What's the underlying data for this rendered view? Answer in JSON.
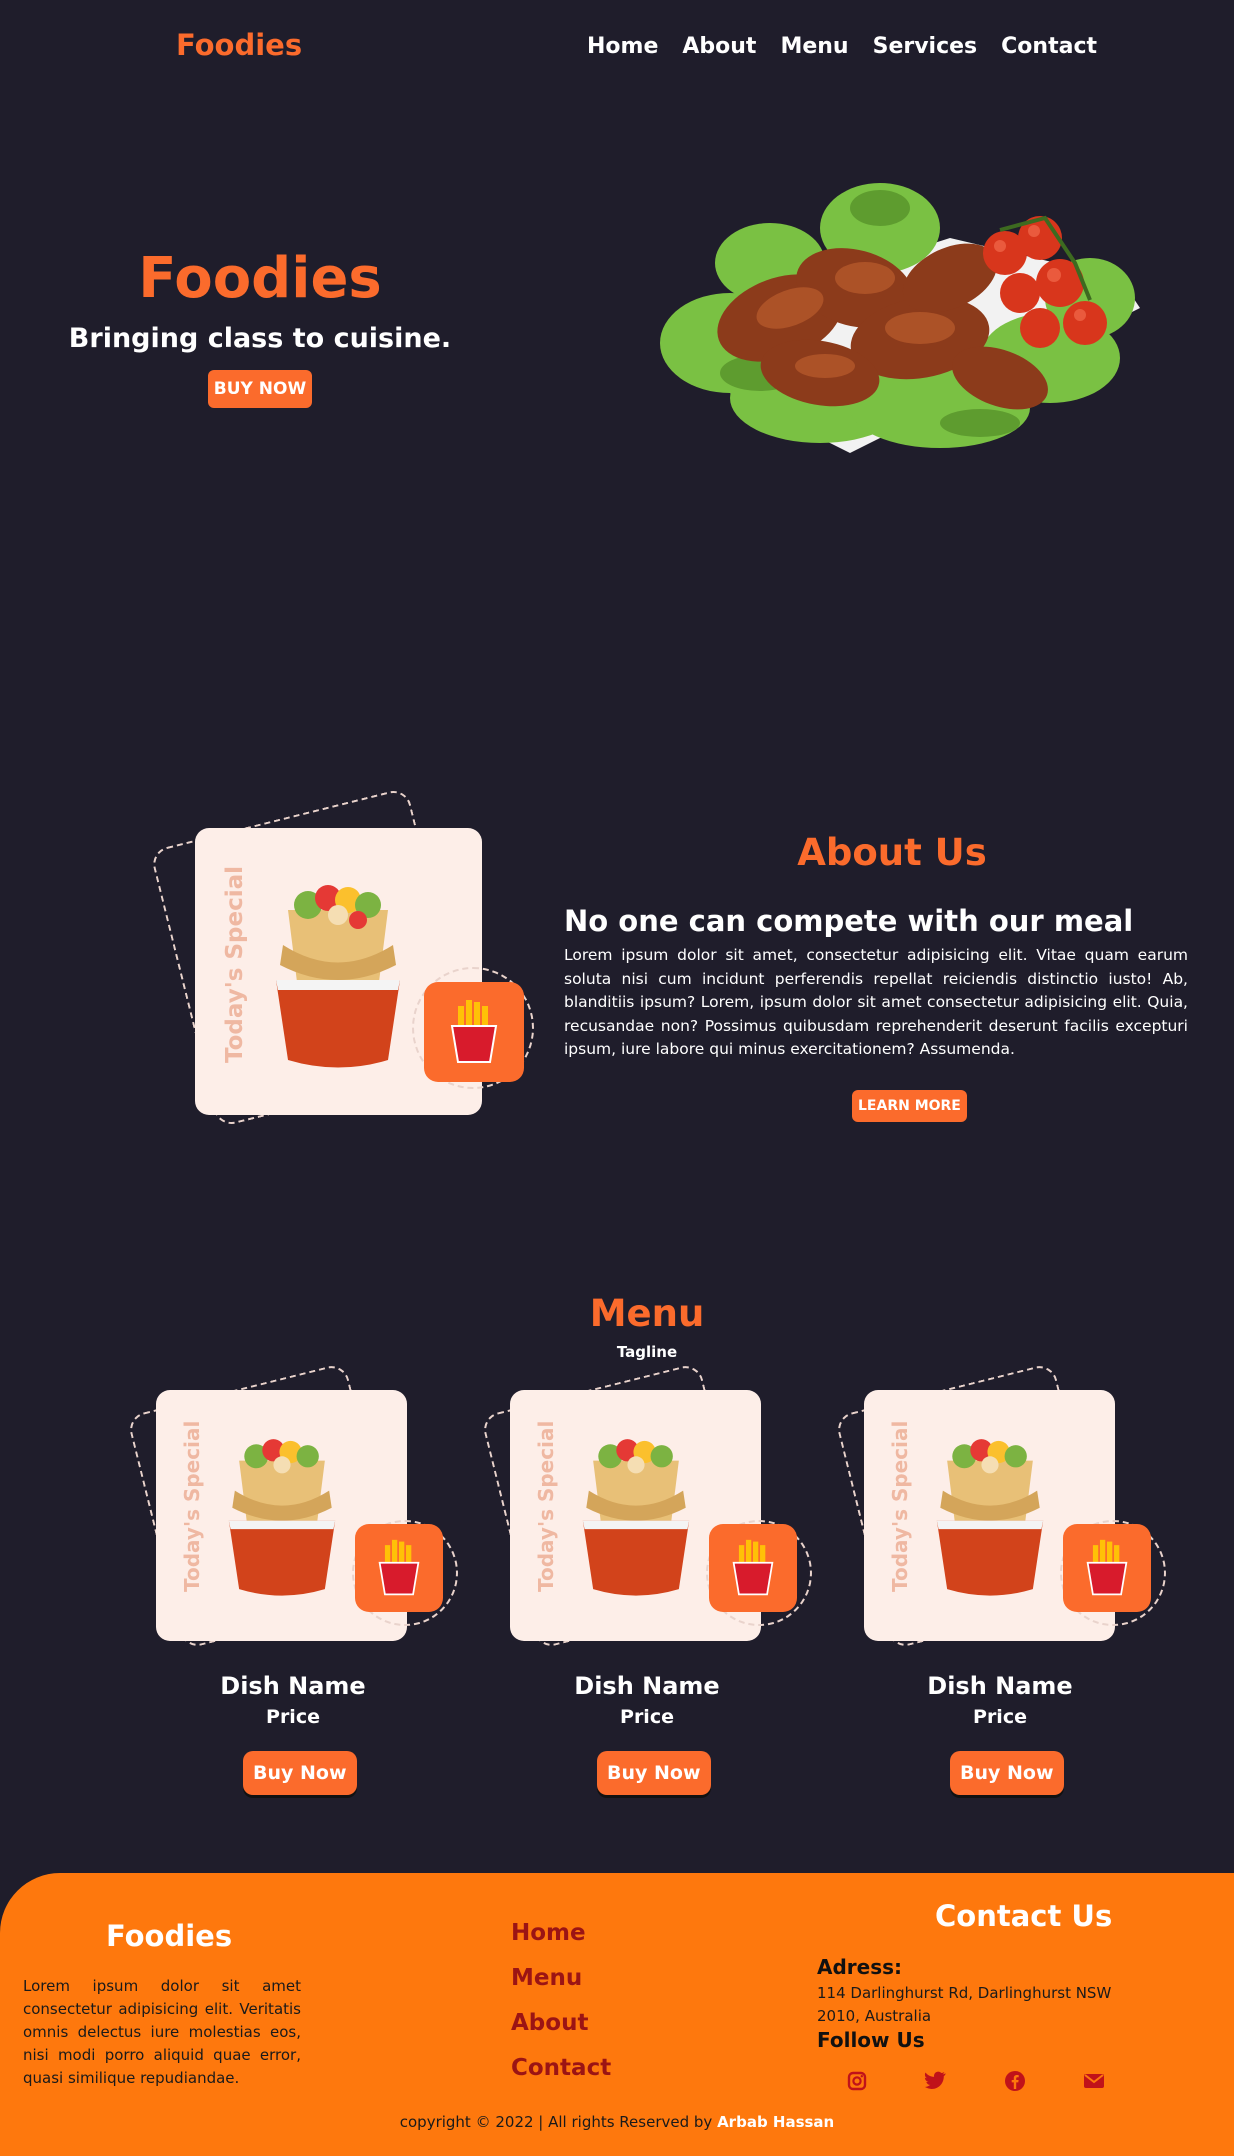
{
  "nav": {
    "brand": "Foodies",
    "links": [
      "Home",
      "About",
      "Menu",
      "Services",
      "Contact"
    ]
  },
  "hero": {
    "title": "Foodies",
    "tagline": "Bringing class to cuisine.",
    "button": "BUY NOW"
  },
  "special_label": "Today's Special",
  "about": {
    "title": "About Us",
    "heading": "No one can compete with our meal",
    "body": "Lorem ipsum dolor sit amet, consectetur adipisicing elit. Vitae quam earum soluta nisi cum incidunt perferendis repellat reiciendis distinctio iusto! Ab, blanditiis ipsum? Lorem, ipsum dolor sit amet consectetur adipisicing elit. Quia, recusandae non? Possimus quibusdam reprehenderit deserunt facilis excepturi ipsum, iure labore qui minus exercitationem? Assumenda.",
    "button": "LEARN MORE"
  },
  "menu": {
    "title": "Menu",
    "tagline": "Tagline",
    "items": [
      {
        "name": "Dish Name",
        "price": "Price",
        "button": "Buy Now"
      },
      {
        "name": "Dish Name",
        "price": "Price",
        "button": "Buy Now"
      },
      {
        "name": "Dish Name",
        "price": "Price",
        "button": "Buy Now"
      }
    ]
  },
  "footer": {
    "brand": "Foodies",
    "text": "Lorem ipsum dolor sit amet consectetur adipisicing elit. Veritatis omnis delectus iure molestias eos, nisi modi porro aliquid quae error, quasi similique repudiandae.",
    "links": [
      "Home",
      "Menu",
      "About",
      "Contact"
    ],
    "contact_title": "Contact Us",
    "address_label": "Adress:",
    "address": "114 Darlinghurst Rd, Darlinghurst NSW 2010, Australia",
    "follow_label": "Follow Us",
    "social_icons": [
      "instagram-icon",
      "twitter-icon",
      "facebook-icon",
      "mail-icon"
    ],
    "copyright": "copyright © 2022 | All rights Reserved by",
    "author": "Arbab Hassan"
  },
  "colors": {
    "background": "#1f1d2b",
    "accent": "#fb6b2c",
    "footer": "#fe780d"
  }
}
